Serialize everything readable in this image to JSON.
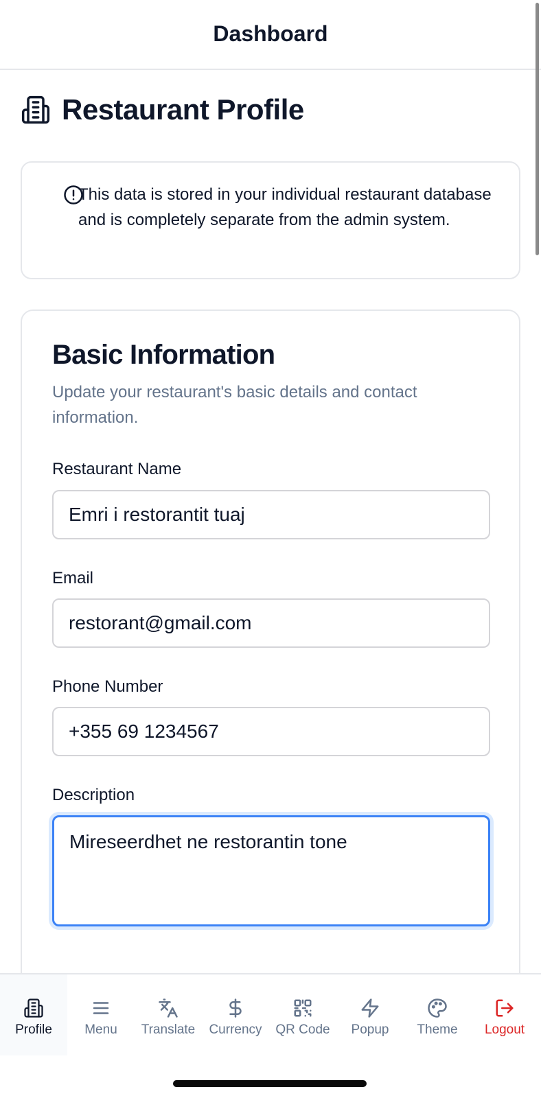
{
  "header": {
    "title": "Dashboard"
  },
  "page": {
    "title": "Restaurant Profile",
    "title_icon": "building-icon"
  },
  "alert": {
    "icon": "info-circle-icon",
    "text": "This data is stored in your individual restaurant database and is completely separate from the admin system."
  },
  "basic_info": {
    "title": "Basic Information",
    "subtitle": "Update your restaurant's basic details and contact information.",
    "fields": {
      "name": {
        "label": "Restaurant Name",
        "value": "Emri i restorantit tuaj"
      },
      "email": {
        "label": "Email",
        "value": "restorant@gmail.com"
      },
      "phone": {
        "label": "Phone Number",
        "value": "+355 69 1234567"
      },
      "description": {
        "label": "Description",
        "value": "Mireseerdhet ne restorantin tone"
      }
    }
  },
  "tabs": [
    {
      "label": "Profile",
      "icon": "building-icon",
      "active": true
    },
    {
      "label": "Menu",
      "icon": "menu-icon",
      "active": false
    },
    {
      "label": "Translate",
      "icon": "translate-icon",
      "active": false
    },
    {
      "label": "Currency",
      "icon": "dollar-icon",
      "active": false
    },
    {
      "label": "QR Code",
      "icon": "qr-code-icon",
      "active": false
    },
    {
      "label": "Popup",
      "icon": "lightning-icon",
      "active": false
    },
    {
      "label": "Theme",
      "icon": "palette-icon",
      "active": false
    },
    {
      "label": "Logout",
      "icon": "logout-icon",
      "active": false
    }
  ],
  "colors": {
    "accent": "#3b82f6",
    "text": "#0f172a",
    "muted": "#64748b",
    "border": "#e5e7eb",
    "danger": "#dc2626"
  }
}
